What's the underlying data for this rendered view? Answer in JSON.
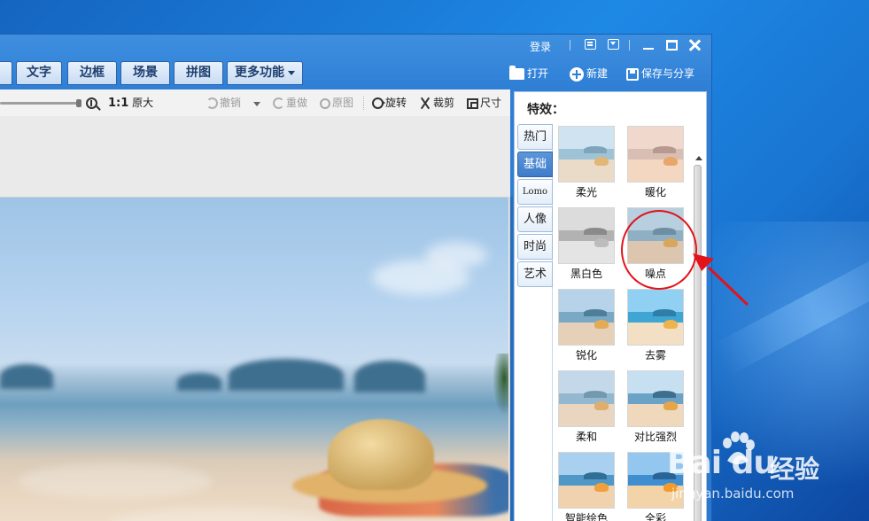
{
  "titlebar": {
    "login_label": "登录"
  },
  "menu_tabs": [
    {
      "label": "文字"
    },
    {
      "label": "边框"
    },
    {
      "label": "场景"
    },
    {
      "label": "拼图"
    },
    {
      "label": "更多功能"
    }
  ],
  "actions": {
    "open_label": "打开",
    "new_label": "新建",
    "save_share_label": "保存与分享"
  },
  "toolbar": {
    "zoom_ratio_label": "1:1",
    "original_size_label": "原大",
    "undo_label": "撤销",
    "redo_label": "重做",
    "original_label": "原图",
    "rotate_label": "旋转",
    "crop_label": "裁剪",
    "size_label": "尺寸"
  },
  "effects_panel": {
    "title": "特效：",
    "categories": [
      {
        "label": "热门",
        "active": false
      },
      {
        "label": "基础",
        "active": true
      },
      {
        "label": "Lomo",
        "active": false
      },
      {
        "label": "人像",
        "active": false
      },
      {
        "label": "时尚",
        "active": false
      },
      {
        "label": "艺术",
        "active": false
      }
    ],
    "effects": [
      {
        "label": "柔光"
      },
      {
        "label": "暖化"
      },
      {
        "label": "黑白色"
      },
      {
        "label": "噪点"
      },
      {
        "label": "锐化"
      },
      {
        "label": "去雾"
      },
      {
        "label": "柔和"
      },
      {
        "label": "对比强烈"
      },
      {
        "label": "智能绘色"
      },
      {
        "label": "全彩"
      }
    ]
  },
  "watermark": {
    "logo_text": "Bai du",
    "product_text": "经验",
    "url_text": "jingyan.baidu.com"
  },
  "colors": {
    "accent": "#2f7fd6",
    "annotation": "#e3121b"
  }
}
